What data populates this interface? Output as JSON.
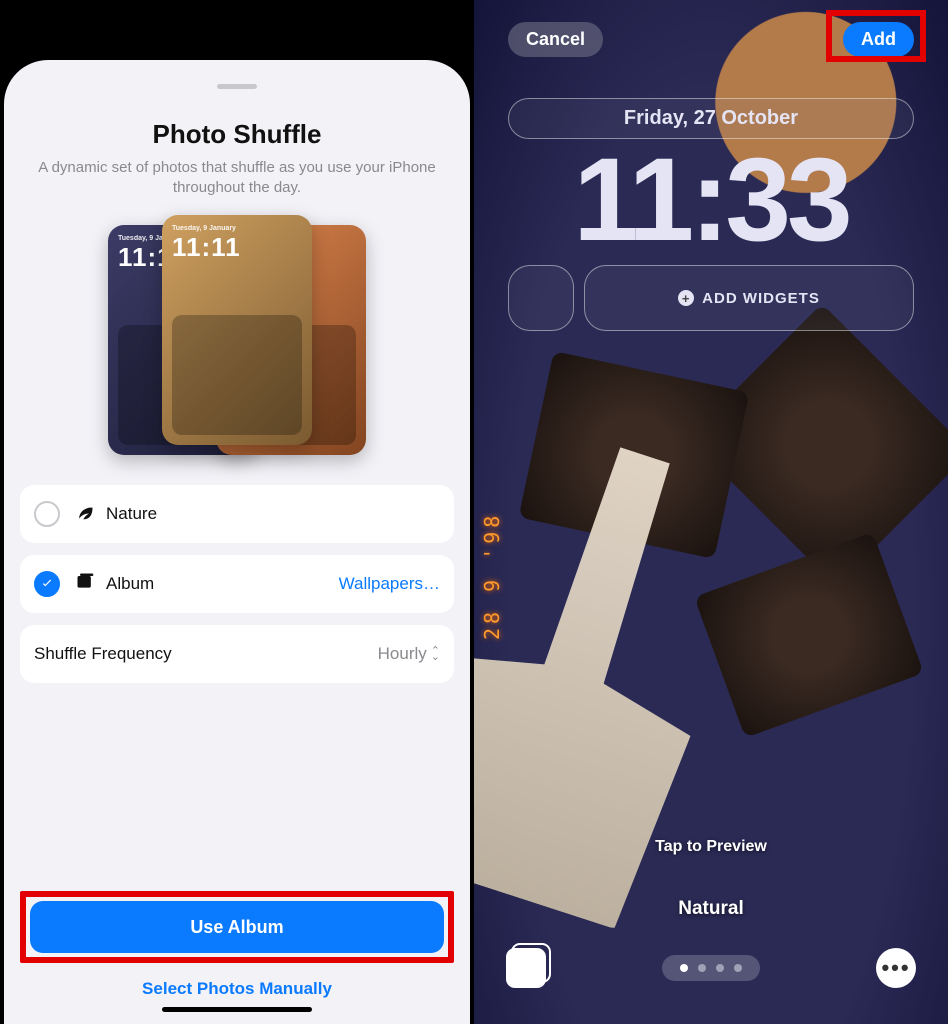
{
  "left": {
    "title": "Photo Shuffle",
    "subtitle": "A dynamic set of photos that shuffle as you use your iPhone throughout the day.",
    "preview_time": "11:11",
    "options": {
      "nature": {
        "label": "Nature",
        "selected": false,
        "icon": "leaf"
      },
      "album": {
        "label": "Album",
        "selected": true,
        "icon": "album",
        "detail": "Wallpapers…"
      }
    },
    "shuffle_row": {
      "label": "Shuffle Frequency",
      "value": "Hourly"
    },
    "primary_button": "Use Album",
    "secondary_link": "Select Photos Manually"
  },
  "right": {
    "cancel": "Cancel",
    "add": "Add",
    "date": "Friday, 27 October",
    "time": "11:33",
    "add_widgets": "ADD WIDGETS",
    "tap_preview": "Tap to Preview",
    "style": "Natural",
    "film_date": "28 9 '98",
    "pager": {
      "count": 4,
      "active": 0
    }
  }
}
